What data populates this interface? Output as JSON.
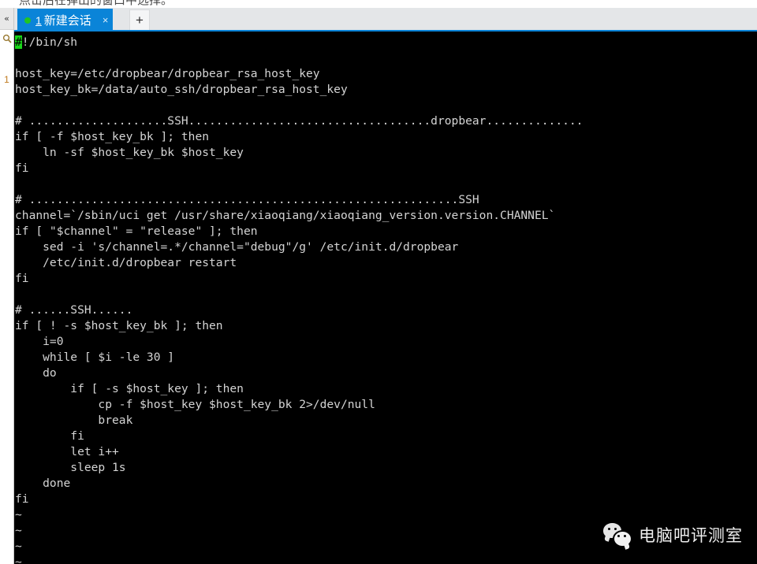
{
  "banner": {
    "clipped_text": "点击后在弹出的窗口中选择。"
  },
  "rail": {
    "collapse_icon": "«",
    "search_icon": "search-icon",
    "session_number": "1"
  },
  "tabbar": {
    "tab": {
      "index": "1",
      "title": "新建会话",
      "close_label": "×",
      "status_dot_color": "#22c522",
      "active_color": "#0a84d8"
    },
    "add_tab_label": "+"
  },
  "terminal": {
    "background": "#000000",
    "foreground": "#d4d4d4",
    "cursor_color": "#19d619",
    "cursor_char": "#",
    "lines": [
      "#!/bin/sh",
      "",
      "host_key=/etc/dropbear/dropbear_rsa_host_key",
      "host_key_bk=/data/auto_ssh/dropbear_rsa_host_key",
      "",
      "# ....................SSH...................................dropbear..............",
      "if [ -f $host_key_bk ]; then",
      "    ln -sf $host_key_bk $host_key",
      "fi",
      "",
      "# ..............................................................SSH",
      "channel=`/sbin/uci get /usr/share/xiaoqiang/xiaoqiang_version.version.CHANNEL`",
      "if [ \"$channel\" = \"release\" ]; then",
      "    sed -i 's/channel=.*/channel=\"debug\"/g' /etc/init.d/dropbear",
      "    /etc/init.d/dropbear restart",
      "fi",
      "",
      "# ......SSH......",
      "if [ ! -s $host_key_bk ]; then",
      "    i=0",
      "    while [ $i -le 30 ]",
      "    do",
      "        if [ -s $host_key ]; then",
      "            cp -f $host_key $host_key_bk 2>/dev/null",
      "            break",
      "        fi",
      "        let i++",
      "        sleep 1s",
      "    done",
      "fi",
      "~",
      "~",
      "~",
      "~"
    ]
  },
  "watermark": {
    "logo": "wechat-logo",
    "text": "电脑吧评测室"
  }
}
